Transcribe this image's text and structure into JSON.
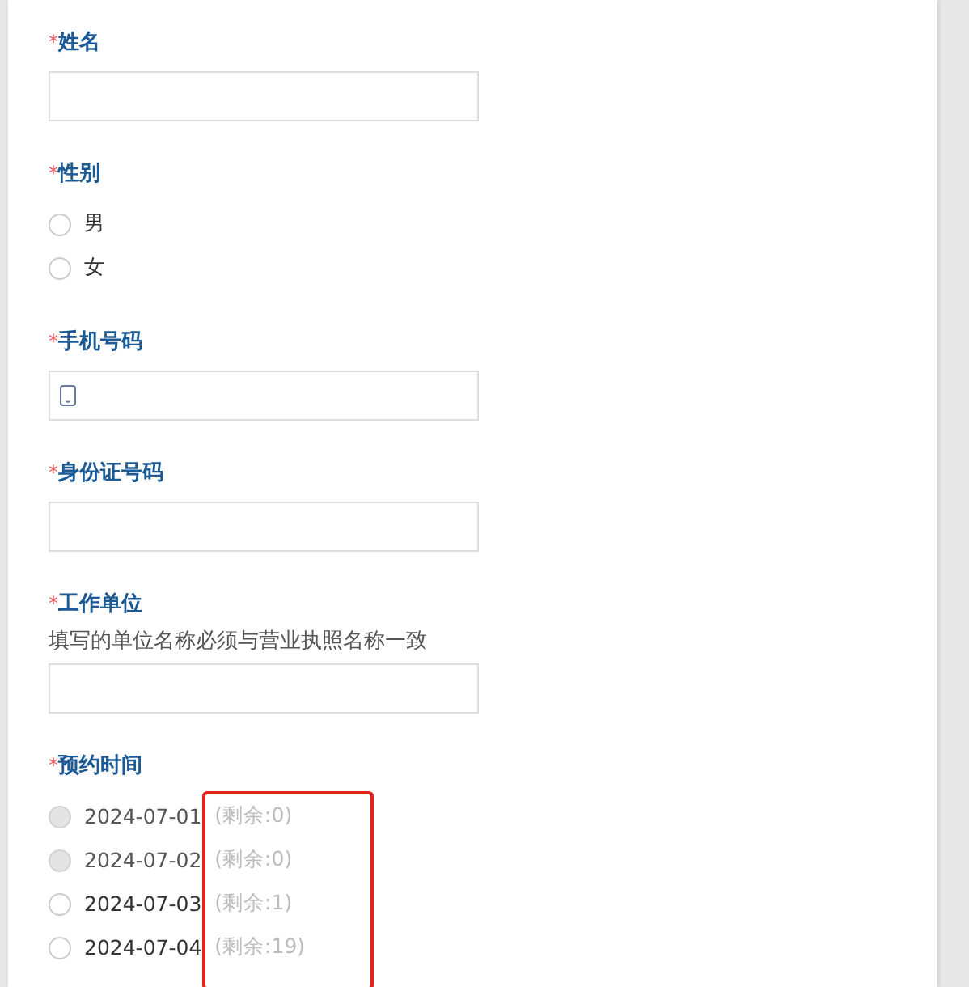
{
  "fields": [
    {
      "kind": "text",
      "label": "姓名",
      "mark": "*"
    },
    {
      "kind": "radio",
      "label": "性别",
      "mark": "*",
      "options": [
        {
          "label": "男",
          "selected": false,
          "disabled": false
        },
        {
          "label": "女",
          "selected": false,
          "disabled": false
        }
      ]
    },
    {
      "kind": "phone",
      "label": "手机号码",
      "mark": "*"
    },
    {
      "kind": "text",
      "label": "身份证号码",
      "mark": "*"
    },
    {
      "kind": "text",
      "label": "工作单位",
      "mark": "*",
      "hint": "填写的单位名称必须与营业执照名称一致"
    },
    {
      "kind": "radio",
      "label": "预约时间",
      "mark": "*",
      "highlight": true,
      "options": [
        {
          "label": "2024-07-01",
          "note": "(剩余:0)",
          "selected": false,
          "disabled": true
        },
        {
          "label": "2024-07-02",
          "note": "(剩余:0)",
          "selected": false,
          "disabled": true
        },
        {
          "label": "2024-07-03",
          "note": "(剩余:1)",
          "selected": false,
          "disabled": false
        },
        {
          "label": "2024-07-04",
          "note": "(剩余:19)",
          "selected": false,
          "disabled": false
        }
      ]
    }
  ]
}
